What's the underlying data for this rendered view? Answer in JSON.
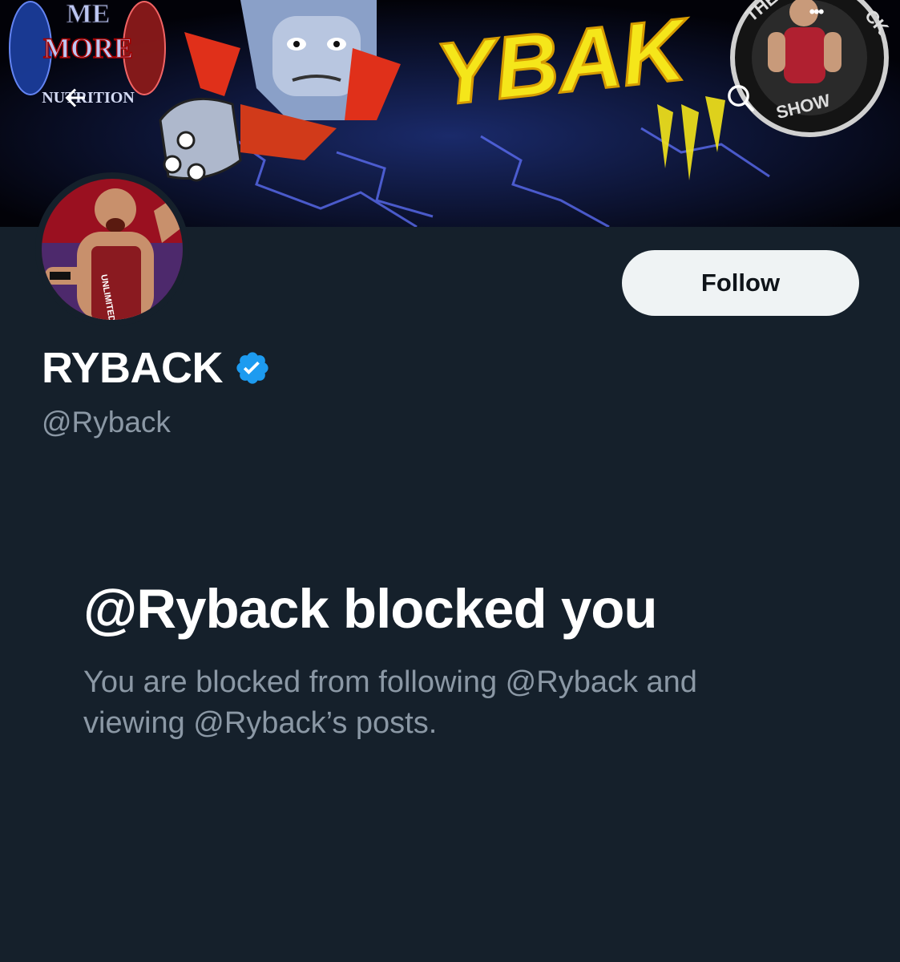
{
  "banner": {
    "logo_left_lines": [
      "ME",
      "MORE",
      "NUTRITION"
    ],
    "title_art_text": "YBAK",
    "badge_top": "THE",
    "badge_right": "CK",
    "badge_bottom": "SHOW"
  },
  "header": {
    "back_icon": "arrow-left-icon",
    "search_icon": "search-icon",
    "more_icon": "more-horizontal-icon",
    "more_glyph": "•••"
  },
  "profile": {
    "display_name": "RYBACK",
    "handle": "@Ryback",
    "verified": true,
    "follow_label": "Follow",
    "avatar_text": "UNLIMITED"
  },
  "blocked": {
    "title": "@Ryback blocked you",
    "description": "You are blocked from following @Ryback and viewing @Ryback’s posts."
  },
  "colors": {
    "background": "#15202b",
    "primary_text": "#ffffff",
    "secondary_text": "#8b98a5",
    "verified_blue": "#1d9bf0",
    "follow_bg": "#eff3f4",
    "follow_text": "#0f1419"
  }
}
